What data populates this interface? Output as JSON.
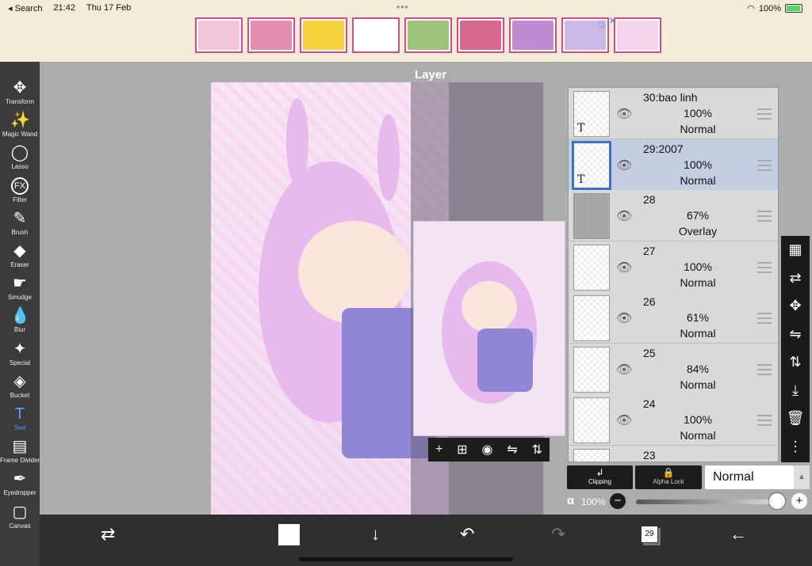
{
  "status_bar": {
    "back_label": "◂ Search",
    "time": "21:42",
    "date": "Thu 17 Feb",
    "battery": "100%",
    "dots": "•••"
  },
  "ad": {
    "info_icon": "info-icon",
    "close": "✕",
    "thumbnails": [
      {
        "name": "ad-talking-cat",
        "color": "#f2c6d9"
      },
      {
        "name": "ad-family",
        "color": "#e58dae"
      },
      {
        "name": "ad-among-us",
        "color": "#f7d23f"
      },
      {
        "name": "ad-pony-coloring",
        "color": "#ffffff"
      },
      {
        "name": "ad-cats",
        "color": "#9bc37a"
      },
      {
        "name": "ad-ladybug",
        "color": "#d66a8f"
      },
      {
        "name": "ad-moms",
        "color": "#c08bd0"
      },
      {
        "name": "ad-among-us-red",
        "color": "#c9b8e8"
      },
      {
        "name": "ad-pony-pink",
        "color": "#f4d5ec"
      }
    ]
  },
  "left_toolbar": {
    "tools": [
      {
        "label": "Transform",
        "icon": "✥",
        "active": false
      },
      {
        "label": "Magic Wand",
        "icon": "✨",
        "active": false
      },
      {
        "label": "Lasso",
        "icon": "◯",
        "active": false
      },
      {
        "label": "Filter",
        "icon": "FX",
        "active": false
      },
      {
        "label": "Brush",
        "icon": "✎",
        "active": false
      },
      {
        "label": "Eraser",
        "icon": "◆",
        "active": false
      },
      {
        "label": "Smudge",
        "icon": "☛",
        "active": false
      },
      {
        "label": "Blur",
        "icon": "💧",
        "active": false
      },
      {
        "label": "Special",
        "icon": "✦",
        "active": false
      },
      {
        "label": "Bucket",
        "icon": "◈",
        "active": false
      },
      {
        "label": "Text",
        "icon": "T",
        "active": true
      },
      {
        "label": "Frame Divider",
        "icon": "▤",
        "active": false
      },
      {
        "label": "Eyedropper",
        "icon": "✒",
        "active": false
      },
      {
        "label": "Canvas",
        "icon": "▢",
        "active": false
      }
    ]
  },
  "layer_panel": {
    "title": "Layer",
    "layers": [
      {
        "name": "30:bao linh",
        "opacity": "100%",
        "blend": "Normal",
        "thumb": "text",
        "selected": false
      },
      {
        "name": "29:2007",
        "opacity": "100%",
        "blend": "Normal",
        "thumb": "text",
        "selected": true
      },
      {
        "name": "28",
        "opacity": "67%",
        "blend": "Overlay",
        "thumb": "noise",
        "selected": false
      },
      {
        "name": "27",
        "opacity": "100%",
        "blend": "Normal",
        "thumb": "empty",
        "selected": false
      },
      {
        "name": "26",
        "opacity": "61%",
        "blend": "Normal",
        "thumb": "empty",
        "selected": false
      },
      {
        "name": "25",
        "opacity": "84%",
        "blend": "Normal",
        "thumb": "empty",
        "selected": false
      },
      {
        "name": "24",
        "opacity": "100%",
        "blend": "Normal",
        "thumb": "empty",
        "selected": false
      },
      {
        "name": "23",
        "opacity": "",
        "blend": "",
        "thumb": "empty",
        "selected": false
      }
    ],
    "clipping_label": "Clipping",
    "alpha_lock_label": "Alpha Lock",
    "blend_mode": "Normal",
    "alpha_symbol": "α",
    "alpha_value": "100%",
    "alpha_fraction": 1.0
  },
  "right_toolbar": {
    "tools": [
      "checkerboard-icon",
      "reference-icon",
      "move-icon",
      "flip-horizontal-icon",
      "flip-vertical-icon",
      "merge-down-icon",
      "trash-icon",
      "more-icon"
    ],
    "glyphs": [
      "▦",
      "⇄",
      "✥",
      "⇋",
      "⇅",
      "⤓",
      "🗑",
      "⋮"
    ]
  },
  "preview_toolbar": {
    "glyphs": [
      "+",
      "⊞",
      "◉",
      "⇋",
      "⇅"
    ]
  },
  "bottom_bar": {
    "layers_count": "29",
    "glyphs": {
      "swap": "⇄",
      "down": "↓",
      "undo": "↶",
      "redo": "↷",
      "back": "←"
    }
  }
}
